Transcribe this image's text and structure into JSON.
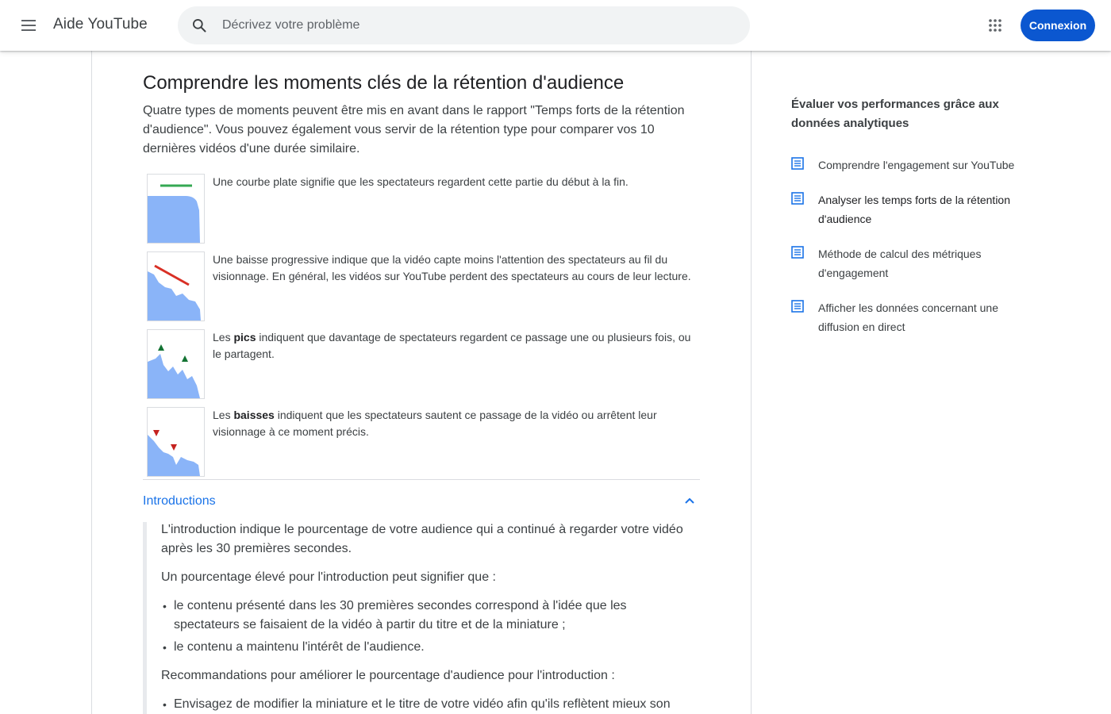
{
  "header": {
    "app_title": "Aide YouTube",
    "search_placeholder": "Décrivez votre problème",
    "signin_label": "Connexion"
  },
  "article": {
    "title": "Comprendre les moments clés de la rétention d'audience",
    "intro": "Quatre types de moments peuvent être mis en avant dans le rapport \"Temps forts de la rétention d'audience\". Vous pouvez également vous servir de la rétention type pour comparer vos 10 dernières vidéos d'une durée similaire.",
    "moments": [
      {
        "pre": "",
        "bold": "",
        "post": "Une courbe plate signifie que les spectateurs regardent cette partie du début à la fin."
      },
      {
        "pre": "",
        "bold": "",
        "post": "Une baisse progressive indique que la vidéo capte moins l'attention des spectateurs au fil du visionnage. En général, les vidéos sur YouTube perdent des spectateurs au cours de leur lecture."
      },
      {
        "pre": "Les ",
        "bold": "pics",
        "post": " indiquent que davantage de spectateurs regardent ce passage une ou plusieurs fois, ou le partagent."
      },
      {
        "pre": "Les ",
        "bold": "baisses",
        "post": " indiquent que les spectateurs sautent ce passage de la vidéo ou arrêtent leur visionnage à ce moment précis."
      }
    ],
    "accordion": {
      "title": "Introductions",
      "p1": "L'introduction indique le pourcentage de votre audience qui a continué à regarder votre vidéo après les 30 premières secondes.",
      "p2": "Un pourcentage élevé pour l'introduction peut signifier que :",
      "bullets": [
        "le contenu présenté dans les 30 premières secondes correspond à l'idée que les spectateurs se faisaient de la vidéo à partir du titre et de la miniature ;",
        "le contenu a maintenu l'intérêt de l'audience."
      ],
      "p3": "Recommandations pour améliorer le pourcentage d'audience pour l'introduction :",
      "bullet_cut": "Envisagez de modifier la miniature et le titre de votre vidéo afin qu'ils reflètent mieux son"
    }
  },
  "sidebar": {
    "title": "Évaluer vos performances grâce aux données analytiques",
    "items": [
      {
        "label": "Comprendre l'engagement sur YouTube"
      },
      {
        "label": "Analyser les temps forts de la rétention d'audience"
      },
      {
        "label": "Méthode de calcul des métriques d'engagement"
      },
      {
        "label": "Afficher les données concernant une diffusion en direct"
      }
    ]
  },
  "colors": {
    "accent_blue": "#1a73e8",
    "button_blue": "#0b57d0",
    "chart_fill": "#8ab4f8",
    "flat_line_green": "#34a853",
    "decline_line_red": "#d93025",
    "spike_green": "#137333",
    "dip_red": "#c5221f"
  }
}
